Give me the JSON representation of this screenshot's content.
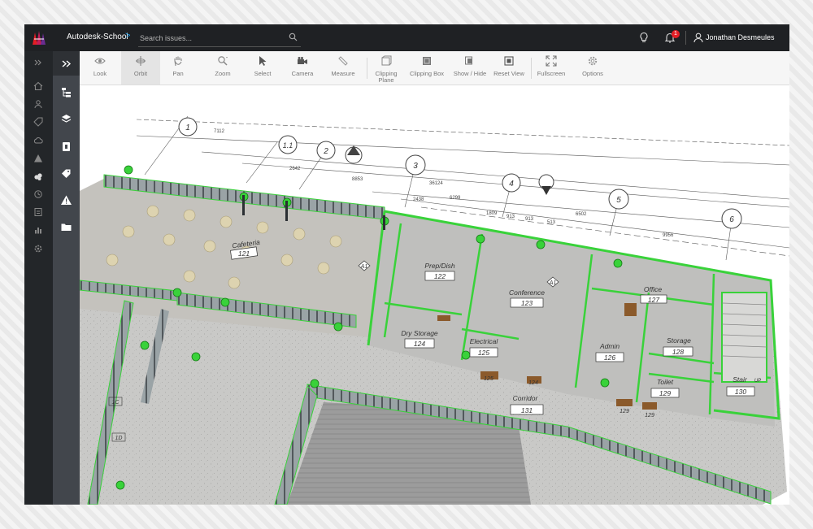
{
  "header": {
    "project": "Autodesk-School",
    "breadcrumb_sep": ">",
    "search_placeholder": "Search issues...",
    "notification_count": "1",
    "user_name": "Jonathan Desmeules"
  },
  "toolbar": {
    "tools": [
      {
        "label": "Look",
        "icon": "eye-icon"
      },
      {
        "label": "Orbit",
        "icon": "orbit-icon",
        "selected": true
      },
      {
        "label": "Pan",
        "icon": "hand-icon"
      },
      {
        "label": "Zoom",
        "icon": "zoom-icon"
      },
      {
        "label": "Select",
        "icon": "cursor-icon"
      },
      {
        "label": "Camera",
        "icon": "camera-icon"
      },
      {
        "label": "Measure",
        "icon": "ruler-icon"
      },
      {
        "label": "Clipping Plane",
        "icon": "clipping-plane-icon"
      },
      {
        "label": "Clipping Box",
        "icon": "clipping-box-icon"
      },
      {
        "label": "Show / Hide",
        "icon": "show-hide-icon"
      },
      {
        "label": "Reset View",
        "icon": "reset-view-icon"
      },
      {
        "label": "Fullscreen",
        "icon": "fullscreen-icon"
      },
      {
        "label": "Options",
        "icon": "gear-icon"
      }
    ]
  },
  "model": {
    "grid_labels": [
      "1",
      "1.1",
      "2",
      "3",
      "4",
      "5",
      "6"
    ],
    "dimensions": [
      "7112",
      "2642",
      "8853",
      "36124",
      "2438",
      "6299",
      "6502",
      "9956",
      "913",
      "1809",
      "913",
      "513"
    ],
    "rooms": [
      {
        "name": "Cafeteria",
        "number": "121"
      },
      {
        "name": "Prep/Dish",
        "number": "122"
      },
      {
        "name": "Conference",
        "number": "123"
      },
      {
        "name": "Dry Storage",
        "number": "124"
      },
      {
        "name": "Electrical",
        "number": "125"
      },
      {
        "name": "Admin",
        "number": "126"
      },
      {
        "name": "Office",
        "number": "127"
      },
      {
        "name": "Storage",
        "number": "128"
      },
      {
        "name": "Toilet",
        "number": "129"
      },
      {
        "name": "Stair",
        "number": "130"
      },
      {
        "name": "Corridor",
        "number": "131"
      }
    ],
    "tags": [
      "A1",
      "A1",
      "1C",
      "1D",
      "125",
      "124",
      "129",
      "129"
    ],
    "stair_direction": "UP"
  },
  "colors": {
    "topbar": "#1f2124",
    "highlight": "#39d23a",
    "badge": "#e41e26",
    "accent": "#1e9be6"
  }
}
